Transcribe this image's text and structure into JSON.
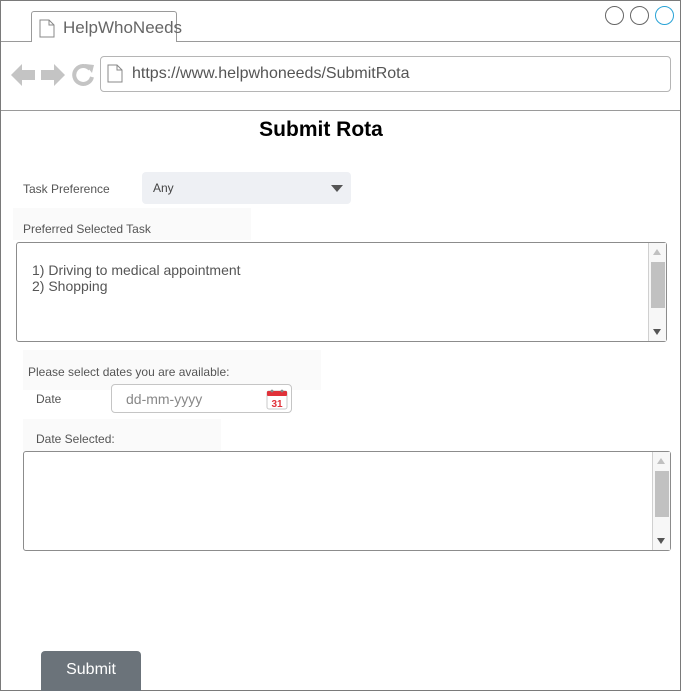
{
  "browser": {
    "tab_title": "HelpWhoNeeds",
    "url": "https://www.helpwhoneeds/SubmitRota"
  },
  "page": {
    "title": "Submit Rota"
  },
  "task_preference": {
    "label": "Task Preference",
    "selected": "Any"
  },
  "preferred_task": {
    "label": "Preferred Selected Task",
    "items": [
      "1) Driving to medical appointment",
      "2) Shopping"
    ]
  },
  "availability": {
    "prompt": "Please select dates you are available:",
    "date_label": "Date",
    "date_placeholder": "dd-mm-yyyy",
    "calendar_day": "31",
    "selected_label": "Date Selected:"
  },
  "actions": {
    "submit_label": "Submit"
  },
  "colors": {
    "accent_blue": "#29a3d6",
    "button_bg": "#6b737a",
    "calendar_red": "#e0323a"
  }
}
